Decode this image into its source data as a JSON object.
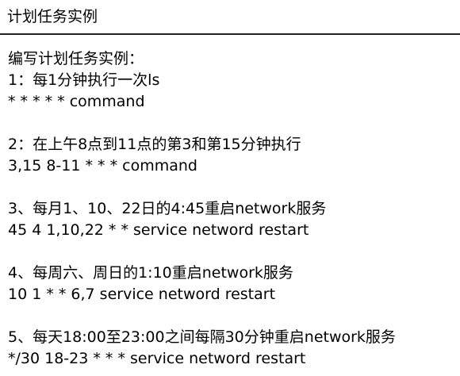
{
  "header": {
    "title": "计划任务实例"
  },
  "intro": "编写计划任务实例：",
  "tasks": [
    {
      "title": "1：每1分钟执行一次ls",
      "command": "* * * * * command"
    },
    {
      "title": "2：在上午8点到11点的第3和第15分钟执行",
      "command": "3,15 8-11 * * * command"
    },
    {
      "title": "3、每月1、10、22日的4:45重启network服务",
      "command": "45 4 1,10,22 * * service netword restart"
    },
    {
      "title": "4、每周六、周日的1:10重启network服务",
      "command": "10 1 * * 6,7 service netword restart"
    },
    {
      "title": "5、每天18:00至23:00之间每隔30分钟重启network服务",
      "command": "*/30 18-23 * * * service netword restart"
    }
  ]
}
